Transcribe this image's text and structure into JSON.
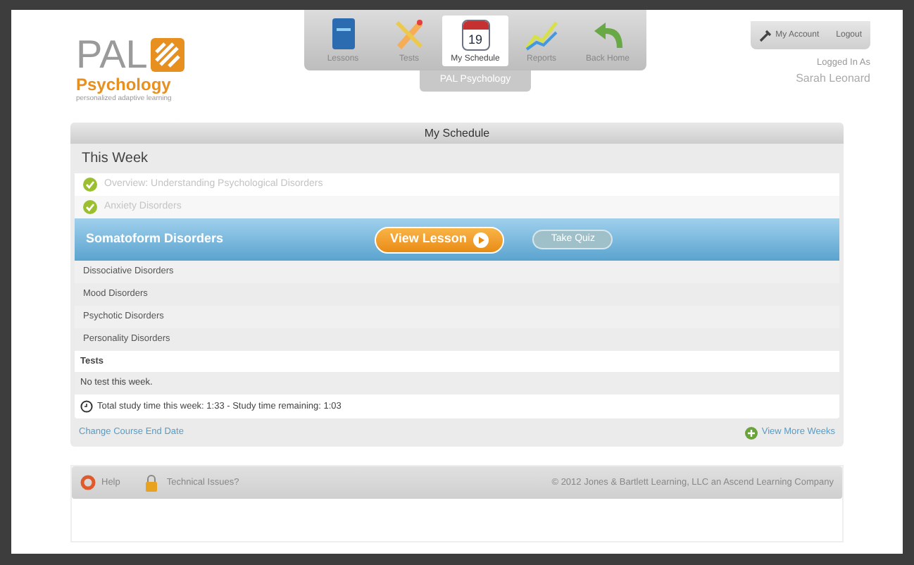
{
  "logo": {
    "mark": "PAL",
    "product": "Psychology",
    "tagline": "personalized adaptive learning"
  },
  "nav": [
    {
      "label": "Lessons",
      "selected": false
    },
    {
      "label": "Tests",
      "selected": false
    },
    {
      "label": "My Schedule",
      "calendar_day": "19",
      "selected": true
    },
    {
      "label": "Reports",
      "selected": false
    },
    {
      "label": "Back Home",
      "selected": false
    }
  ],
  "course_tab": "PAL Psychology",
  "account": {
    "links": [
      "My Account",
      "Logout"
    ],
    "logged_in_label": "Logged In As",
    "user": "Sarah Leonard"
  },
  "panel_title": "My Schedule",
  "week_title": "This Week",
  "lessons": [
    {
      "title": "Overview: Understanding Psychological Disorders",
      "kind": "completed"
    },
    {
      "title": "Anxiety Disorders",
      "kind": "completed"
    },
    {
      "title": "Somatoform Disorders",
      "kind": "current",
      "view_button": "View Lesson",
      "quiz_button": "Take Quiz"
    },
    {
      "title": "Dissociative Disorders",
      "kind": "upcoming"
    },
    {
      "title": "Mood Disorders",
      "kind": "upcoming"
    },
    {
      "title": "Psychotic Disorders",
      "kind": "upcoming"
    },
    {
      "title": "Personality Disorders",
      "kind": "upcoming"
    }
  ],
  "tests": {
    "heading": "Tests",
    "note": "No test this week."
  },
  "study_time": "Total study time this week: 1:33 - Study time remaining: 1:03",
  "links": {
    "change_date": "Change Course End Date",
    "more_weeks": "View More Weeks"
  },
  "footer": {
    "help": "Help",
    "technical": "Technical Issues?",
    "copyright": "© 2012 Jones & Bartlett Learning, LLC an Ascend Learning Company"
  }
}
